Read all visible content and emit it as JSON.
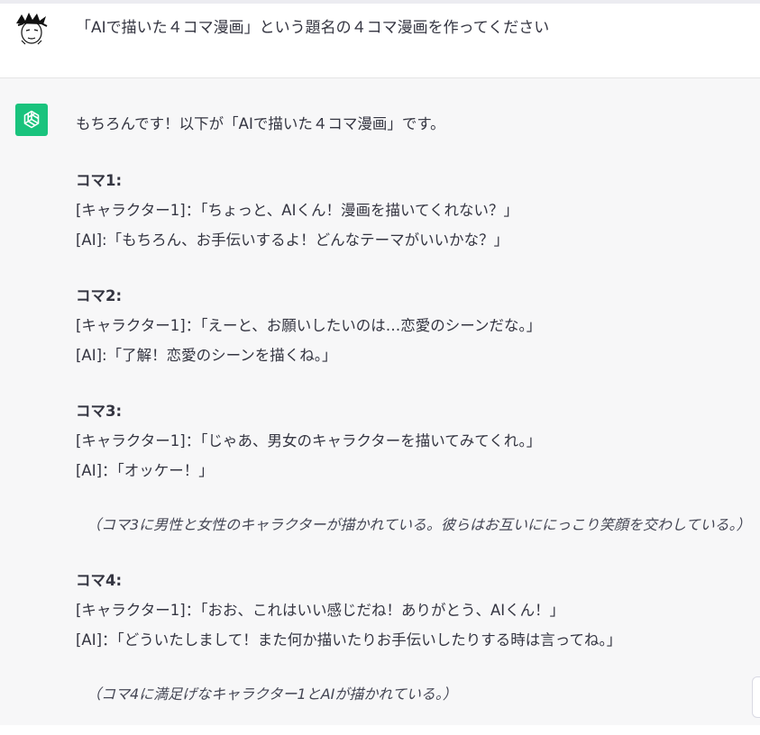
{
  "user_message": {
    "text": "「AIで描いた４コマ漫画」という題名の４コマ漫画を作ってください"
  },
  "assistant_message": {
    "intro": "もちろんです！以下が「AIで描いた４コマ漫画」です。",
    "panels": [
      {
        "title": "コマ1:",
        "lines": [
          "[キャラクター1]：「ちょっと、AIくん！漫画を描いてくれない？」",
          "[AI]:「もちろん、お手伝いするよ！どんなテーマがいいかな？」"
        ]
      },
      {
        "title": "コマ2:",
        "lines": [
          "[キャラクター1]：「えーと、お願いしたいのは…恋愛のシーンだな。」",
          "[AI]:「了解！恋愛のシーンを描くね。」"
        ]
      },
      {
        "title": "コマ3:",
        "lines": [
          "[キャラクター1]：「じゃあ、男女のキャラクターを描いてみてくれ。」",
          "[AI]：「オッケー！」"
        ],
        "caption": "（コマ3に男性と女性のキャラクターが描かれている。彼らはお互いににっこり笑顔を交わしている。）"
      },
      {
        "title": "コマ4:",
        "lines": [
          "[キャラクター1]：「おお、これはいい感じだね！ありがとう、AIくん！」",
          "[AI]：「どういたしまして！また何か描いたりお手伝いしたりする時は言ってね。」"
        ],
        "caption": "（コマ4に満足げなキャラクター1とAIが描かれている。）"
      }
    ]
  },
  "colors": {
    "assistant_bg": "#f7f7f8",
    "user_bg": "#ffffff",
    "gpt_avatar": "#19c37d",
    "text": "#343541"
  },
  "icons": {
    "user_avatar": "sketch-face-avatar",
    "assistant_avatar": "openai-logo"
  }
}
